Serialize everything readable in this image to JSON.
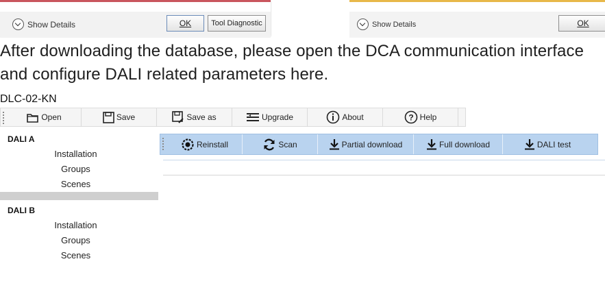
{
  "dialog_left": {
    "show_details": "Show Details",
    "ok": "OK",
    "diagnostic": "Tool Diagnostic"
  },
  "dialog_right": {
    "show_details": "Show Details",
    "ok": "OK"
  },
  "instruction": "After downloading the database, please open the DCA communication interface and configure DALI related parameters here.",
  "app": {
    "title": "DLC-02-KN",
    "toolbar": [
      {
        "label": "Open",
        "icon": "folder-icon"
      },
      {
        "label": "Save",
        "icon": "floppy-icon"
      },
      {
        "label": "Save as",
        "icon": "save-as-icon"
      },
      {
        "label": "Upgrade",
        "icon": "upgrade-icon"
      },
      {
        "label": "About",
        "icon": "info-icon"
      },
      {
        "label": "Help",
        "icon": "help-icon"
      }
    ],
    "sidebar": {
      "dali_a": "DALI A",
      "dali_a_items": [
        "Installation",
        "Groups",
        "Scenes"
      ],
      "dali_b": "DALI B",
      "dali_b_items": [
        "Installation",
        "Groups",
        "Scenes"
      ]
    },
    "subtoolbar": [
      {
        "label": "Reinstall",
        "icon": "reinstall-icon"
      },
      {
        "label": "Scan",
        "icon": "refresh-icon"
      },
      {
        "label": "Partial download",
        "icon": "download-icon"
      },
      {
        "label": "Full download",
        "icon": "download-icon"
      },
      {
        "label": "DALI test",
        "icon": "download-icon"
      }
    ]
  }
}
